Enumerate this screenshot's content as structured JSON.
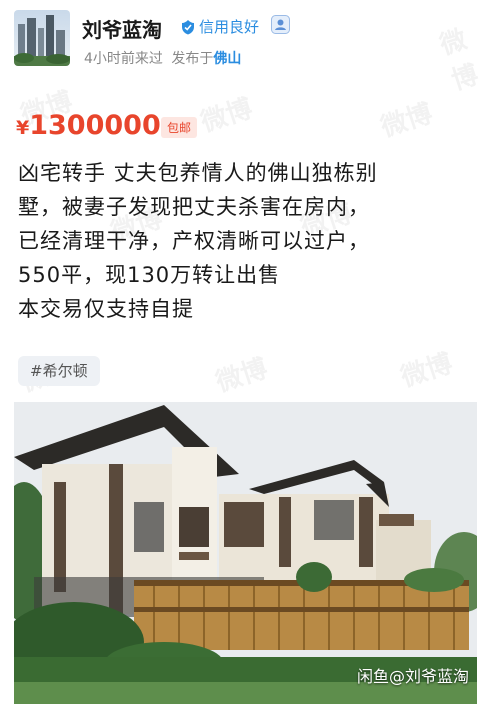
{
  "seller": {
    "name": "刘爷蓝淘",
    "credit": "信用良好",
    "last_seen": "4小时前来过",
    "location_prefix": "发布于",
    "city": "佛山"
  },
  "listing": {
    "price_symbol": "¥",
    "price": "1300000",
    "shipping": "包邮",
    "description_lines": [
      "凶宅转手 丈夫包养情人的佛山独栋别",
      "墅，被妻子发现把丈夫杀害在房内，",
      "已经清理干净，产权清晰可以过户，",
      "550平，现130万转让出售",
      "本交易仅支持自提"
    ],
    "tag": "#希尔顿"
  },
  "photo": {
    "caption": "闲鱼@刘爷蓝淘"
  },
  "icons": [
    "credit-shield-icon",
    "verified-badge-icon"
  ],
  "colors": {
    "price": "#e8452c",
    "link": "#2b8de0"
  }
}
